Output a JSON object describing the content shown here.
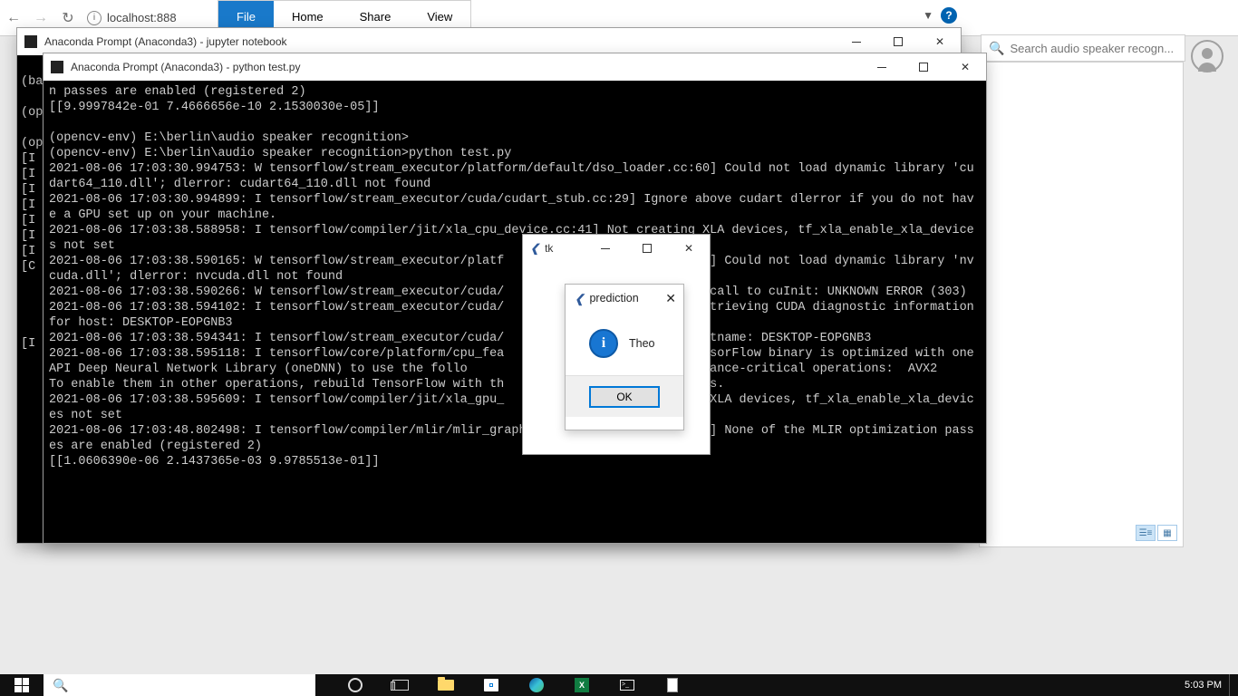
{
  "explorer": {
    "url_text": "localhost:888",
    "ribbon": {
      "file": "File",
      "home": "Home",
      "share": "Share",
      "view": "View"
    },
    "search_placeholder": "Search audio speaker recogn..."
  },
  "window_jupyter": {
    "title": "Anaconda Prompt (Anaconda3) - jupyter  notebook",
    "output": "\n(ba\n\n(op\n\n(op\n[I\n[I\n[I\n[I\n[I\n[I\n[I\n[C\n\n\n\n\n[I"
  },
  "window_python": {
    "title": "Anaconda Prompt (Anaconda3) - python  test.py",
    "output": "n passes are enabled (registered 2)\n[[9.9997842e-01 7.4666656e-10 2.1530030e-05]]\n\n(opencv-env) E:\\berlin\\audio speaker recognition>\n(opencv-env) E:\\berlin\\audio speaker recognition>python test.py\n2021-08-06 17:03:30.994753: W tensorflow/stream_executor/platform/default/dso_loader.cc:60] Could not load dynamic library 'cudart64_110.dll'; dlerror: cudart64_110.dll not found\n2021-08-06 17:03:30.994899: I tensorflow/stream_executor/cuda/cudart_stub.cc:29] Ignore above cudart dlerror if you do not have a GPU set up on your machine.\n2021-08-06 17:03:38.588958: I tensorflow/compiler/jit/xla_cpu_device.cc:41] Not creating XLA devices, tf_xla_enable_xla_devices not set\n2021-08-06 17:03:38.590165: W tensorflow/stream_executor/platf                         :60] Could not load dynamic library 'nvcuda.dll'; dlerror: nvcuda.dll not found\n2021-08-06 17:03:38.590266: W tensorflow/stream_executor/cuda/                          d call to cuInit: UNKNOWN ERROR (303)\n2021-08-06 17:03:38.594102: I tensorflow/stream_executor/cuda/                          retrieving CUDA diagnostic information for host: DESKTOP-EOPGNB3\n2021-08-06 17:03:38.594341: I tensorflow/stream_executor/cuda/                          ostname: DESKTOP-EOPGNB3\n2021-08-06 17:03:38.595118: I tensorflow/core/platform/cpu_fea                          ensorFlow binary is optimized with oneAPI Deep Neural Network Library (oneDNN) to use the follo                          performance-critical operations:  AVX2\nTo enable them in other operations, rebuild TensorFlow with th                          ags.\n2021-08-06 17:03:38.595609: I tensorflow/compiler/jit/xla_gpu_                          g XLA devices, tf_xla_enable_xla_devices not set\n2021-08-06 17:03:48.802498: I tensorflow/compiler/mlir/mlir_graph_optimization_pass.cc:116] None of the MLIR optimization passes are enabled (registered 2)\n[[1.0606390e-06 2.1437365e-03 9.9785513e-01]]"
  },
  "tk_window": {
    "title": "tk"
  },
  "messagebox": {
    "title": "prediction",
    "message": "Theo",
    "ok_label": "OK"
  },
  "taskbar": {
    "clock": "5:03 PM"
  },
  "excel_letter": "X",
  "term_prompt": ">_"
}
